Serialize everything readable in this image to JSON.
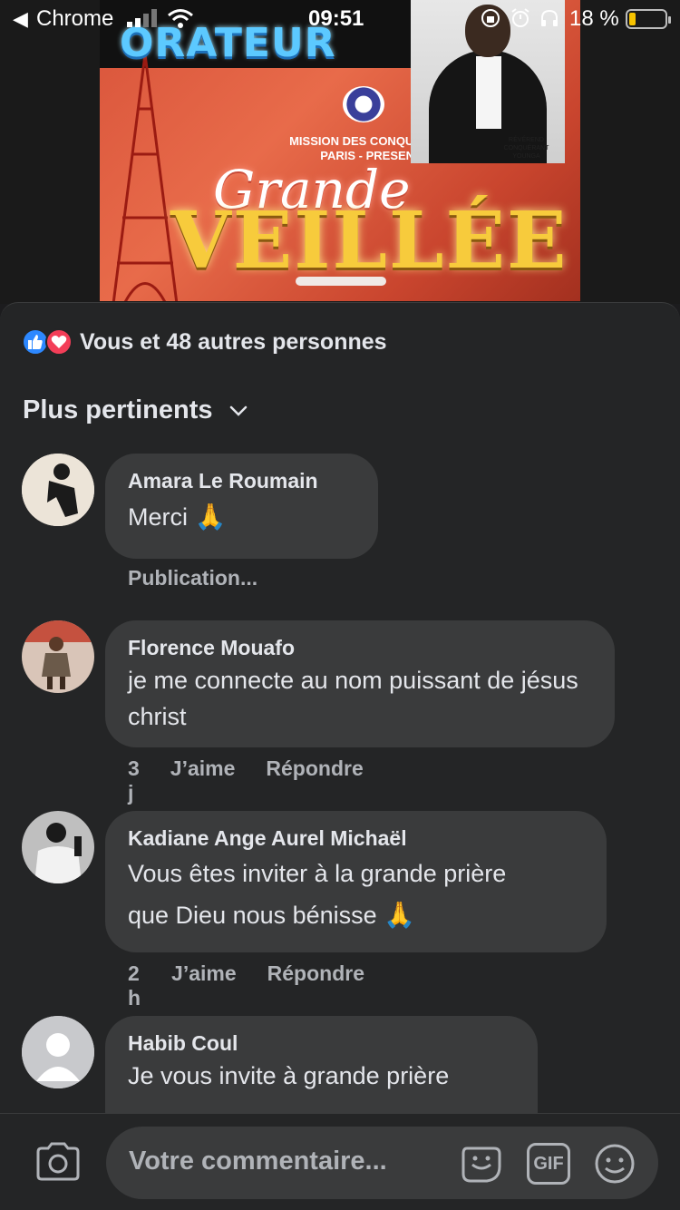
{
  "status_bar": {
    "back_label": "Chrome",
    "time": "09:51",
    "battery_pct": "18 %",
    "battery_level": 0.18
  },
  "video": {
    "poster_orateur": "ORATEUR",
    "poster_mission_line1": "MISSION DES CONQUÉ",
    "poster_mission_line2": "PARIS - PRESENT",
    "poster_grande": "Grande",
    "poster_veillee": "VEILLÉE",
    "portrait_caption": "RÉVÉREND CONQUÉRANT YOUNGA"
  },
  "reactions": {
    "summary": "Vous et 48 autres personnes",
    "icons": [
      "like-icon",
      "love-icon"
    ],
    "colors": {
      "like": "#2d88ff",
      "love": "#f33e58"
    }
  },
  "sort": {
    "label": "Plus pertinents"
  },
  "comments": [
    {
      "author": "Amara Le Roumain",
      "text": "Merci",
      "emoji": "🙏",
      "status": "Publication..."
    },
    {
      "author": "Florence Mouafo",
      "text": "je me connecte au nom puissant de jésus christ",
      "time": "3 j",
      "like": "J’aime",
      "reply": "Répondre"
    },
    {
      "author": "Kadiane Ange Aurel Michaël",
      "text_line1": "Vous êtes inviter à la grande prière",
      "text_line2": "que Dieu nous bénisse",
      "emoji": "🙏",
      "time": "2 h",
      "like": "J’aime",
      "reply": "Répondre"
    },
    {
      "author": "Habib Coul",
      "text": "Je vous invite à grande prière"
    }
  ],
  "composer": {
    "placeholder": "Votre commentaire...",
    "gif_label": "GIF"
  }
}
